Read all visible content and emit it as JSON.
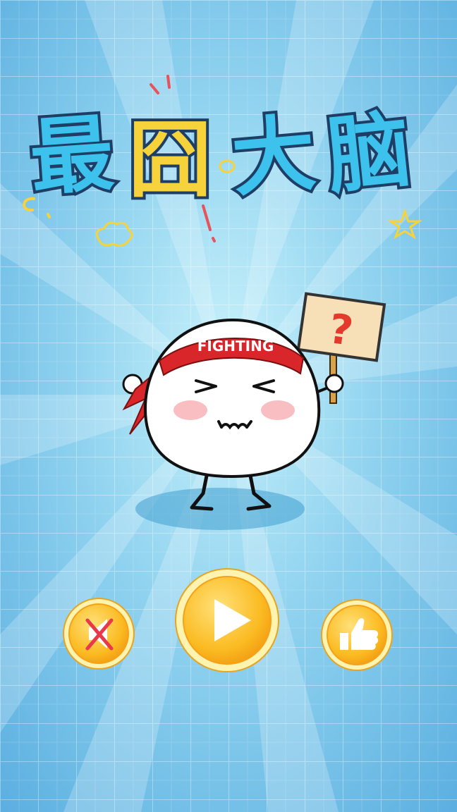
{
  "game": {
    "title": "最囧大脑",
    "title_chars": [
      "最",
      "囧",
      "大",
      "脑"
    ],
    "mascot": {
      "headband_text": "FIGHTING",
      "sign_text": "?"
    }
  },
  "buttons": {
    "sound": {
      "icon": "speaker-muted-icon",
      "state": "muted"
    },
    "play": {
      "icon": "play-icon"
    },
    "like": {
      "icon": "thumbs-up-icon"
    }
  },
  "colors": {
    "background": "#7ec4ea",
    "title_fill": "#3cc2ec",
    "title_outline": "#1e3e66",
    "title_accent": "#f6d33a",
    "button_gold": "#fbbf2a",
    "button_ring": "#fff3b0",
    "headband": "#d8262a",
    "sign": "#f7dfb8"
  }
}
